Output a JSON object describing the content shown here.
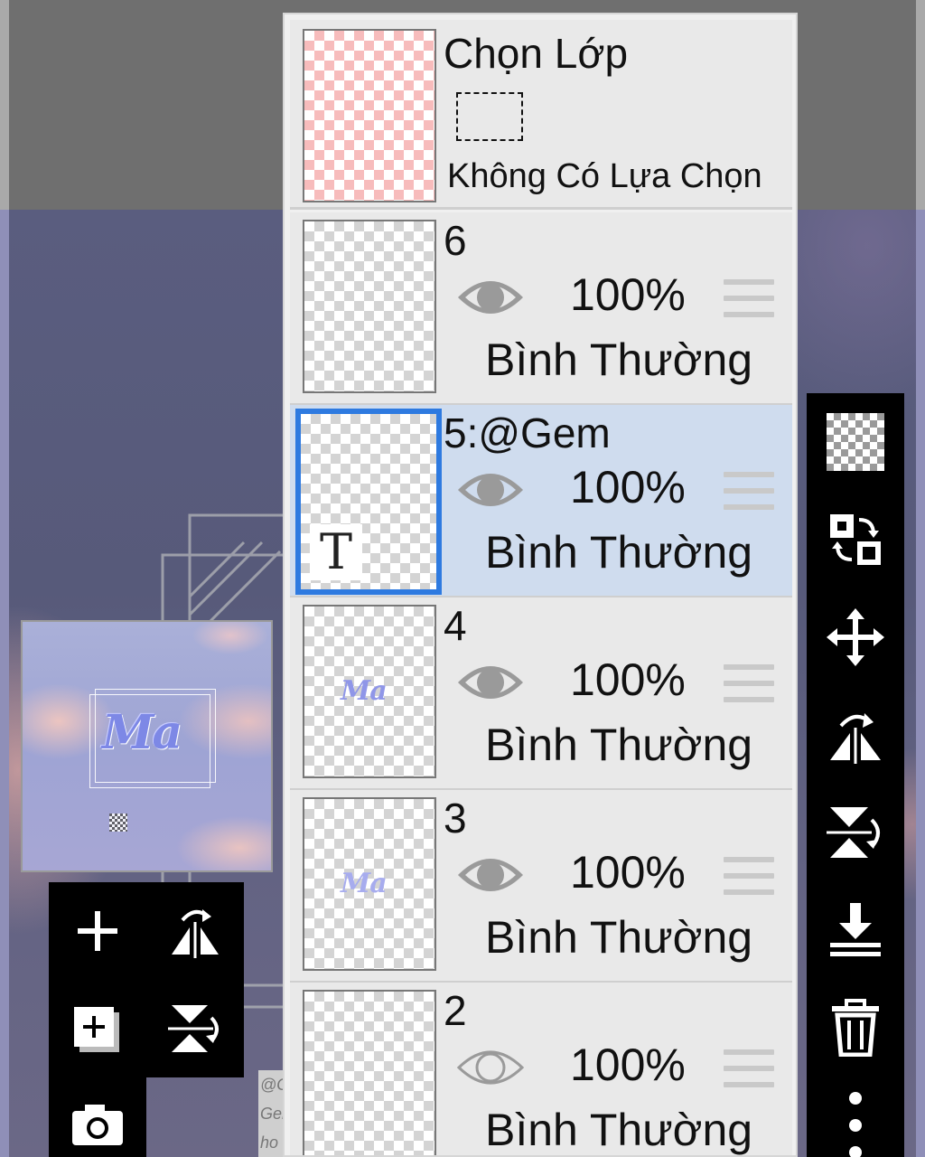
{
  "layer_panel": {
    "selection_layer": {
      "title": "Chọn Lớp",
      "status": "Không Có Lựa Chọn"
    },
    "layers": [
      {
        "name": "6",
        "opacity": "100%",
        "blend_mode": "Bình Thường",
        "visible": true,
        "selected": false
      },
      {
        "name": "5:@Gem",
        "opacity": "100%",
        "blend_mode": "Bình Thường",
        "visible": true,
        "selected": true,
        "type": "text",
        "type_badge": "T"
      },
      {
        "name": "4",
        "opacity": "100%",
        "blend_mode": "Bình Thường",
        "visible": true,
        "selected": false,
        "thumb_text": "Ma"
      },
      {
        "name": "3",
        "opacity": "100%",
        "blend_mode": "Bình Thường",
        "visible": true,
        "selected": false,
        "thumb_text": "Ma"
      },
      {
        "name": "2",
        "opacity": "100%",
        "blend_mode": "Bình Thường",
        "visible": false,
        "selected": false
      }
    ]
  },
  "preview": {
    "text": "Ma"
  },
  "watermark": {
    "lines": [
      "@Ge",
      "Gen",
      "ho"
    ]
  },
  "colors": {
    "selected_row": "#cfdcee",
    "selected_border": "#2e7ae0",
    "toolbar_bg": "#000000",
    "selection_checker": "#f7bcbc"
  },
  "icons": {
    "left_toolbar": [
      "add-layer-icon",
      "flip-horizontal-icon",
      "add-image-layer-icon",
      "flip-vertical-icon",
      "camera-icon"
    ],
    "right_toolbar": [
      "transparency-checker-icon",
      "swap-layer-icon",
      "move-icon",
      "flip-horizontal-icon",
      "flip-vertical-icon",
      "merge-down-icon",
      "delete-icon",
      "more-options-icon"
    ]
  }
}
